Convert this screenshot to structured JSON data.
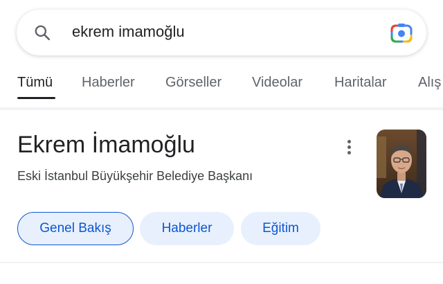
{
  "search": {
    "query": "ekrem imamoğlu"
  },
  "tabs": [
    {
      "label": "Tümü",
      "active": true
    },
    {
      "label": "Haberler",
      "active": false
    },
    {
      "label": "Görseller",
      "active": false
    },
    {
      "label": "Videolar",
      "active": false
    },
    {
      "label": "Haritalar",
      "active": false
    },
    {
      "label": "Alış",
      "active": false
    }
  ],
  "entity": {
    "title": "Ekrem İmamoğlu",
    "subtitle": "Eski İstanbul Büyükşehir Belediye Başkanı",
    "photo_icon": "person-photo",
    "more_icon": "more-vert-icon"
  },
  "chips": [
    {
      "label": "Genel Bakış",
      "active": true
    },
    {
      "label": "Haberler",
      "active": false
    },
    {
      "label": "Eğitim",
      "active": false
    }
  ],
  "colors": {
    "accent": "#0b57d0",
    "chip_bg": "#e8f0fe",
    "text_primary": "#202124",
    "text_secondary": "#5f6368"
  }
}
